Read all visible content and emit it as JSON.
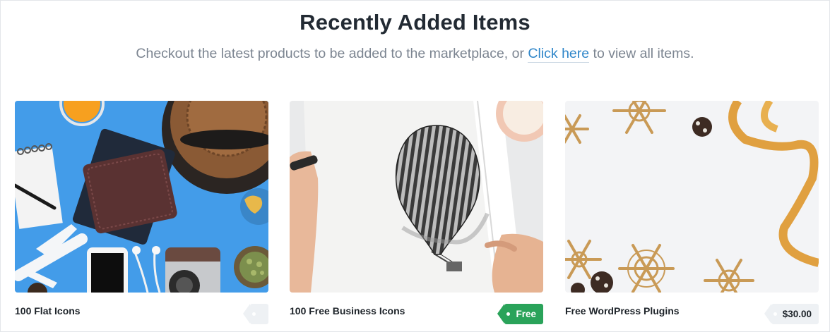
{
  "section": {
    "title": "Recently Added Items",
    "subtitle_before": "Checkout the latest products to be added to the marketplace, or ",
    "subtitle_link": "Click here",
    "subtitle_after": " to view all items."
  },
  "items": [
    {
      "title": "100 Flat Icons",
      "price": "",
      "thumbnail": "flatlay-desk-photo"
    },
    {
      "title": "100 Free Business Icons",
      "price": "Free",
      "thumbnail": "hot-air-balloon-sketch-photo"
    },
    {
      "title": "Free WordPress Plugins",
      "price": "$30.00",
      "thumbnail": "snowflakes-ribbon-photo"
    }
  ],
  "colors": {
    "accent": "#2f86c9",
    "free_badge": "#2aa35a",
    "price_badge": "#eef1f4"
  }
}
